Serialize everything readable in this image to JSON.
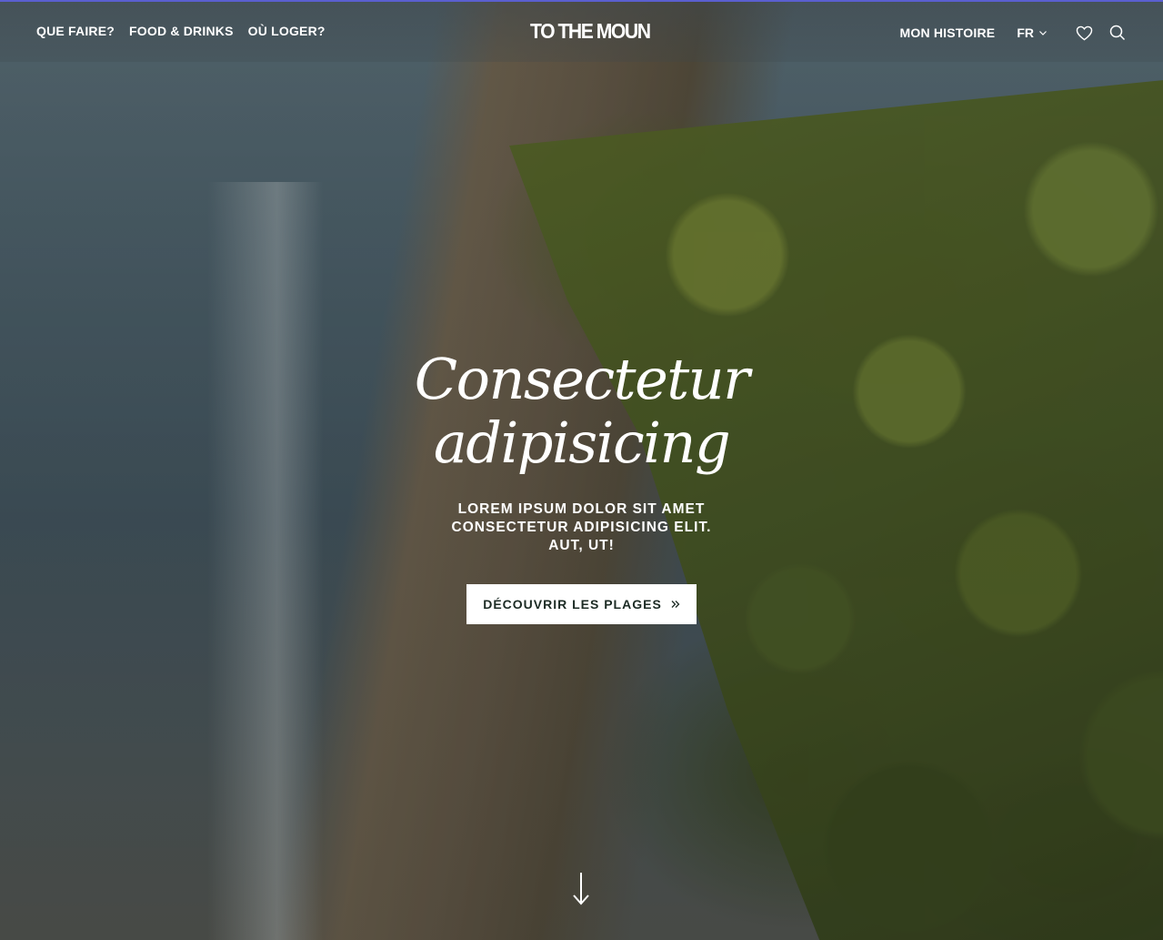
{
  "nav": {
    "left_items": [
      "QUE FAIRE?",
      "FOOD & DRINKS",
      "OÙ LOGER?"
    ],
    "logo": "TO THE MOUN",
    "histoire": "MON HISTOIRE",
    "lang": "FR"
  },
  "hero": {
    "headline_line1": "Consectetur",
    "headline_line2": "adipisicing",
    "subline": "LOREM IPSUM DOLOR SIT AMET CONSECTETUR ADIPISICING ELIT. AUT, UT!",
    "cta_label": "DÉCOUVRIR LES PLAGES"
  },
  "icons": {
    "wishlist": "heart-icon",
    "search": "search-icon",
    "lang_chevron": "chevron-down-icon",
    "cta_arrow": "double-chevron-right-icon",
    "scroll": "arrow-down-icon"
  },
  "colors": {
    "cta_bg": "#ffffff",
    "cta_text": "#1c2b24",
    "accent_border": "#5a5fd0"
  }
}
